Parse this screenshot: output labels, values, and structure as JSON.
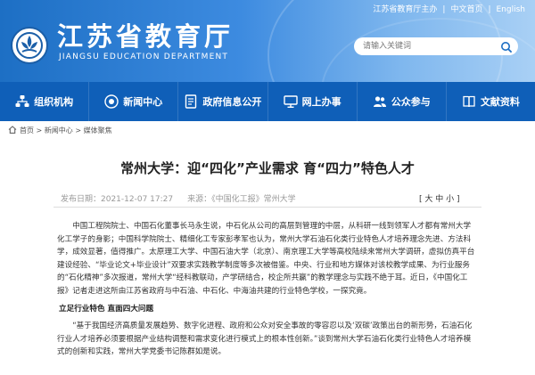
{
  "topbar": {
    "sponsor": "江苏省教育厅主办",
    "chinese": "中文首页",
    "english": "English",
    "sep": "|"
  },
  "site": {
    "title": "江苏省教育厅",
    "subtitle": "JIANGSU EDUCATION DEPARTMENT"
  },
  "search": {
    "placeholder": "请输入关键词"
  },
  "nav": {
    "items": [
      {
        "label": "组织机构",
        "icon": "org-icon"
      },
      {
        "label": "新闻中心",
        "icon": "news-icon"
      },
      {
        "label": "政府信息公开",
        "icon": "document-icon"
      },
      {
        "label": "网上办事",
        "icon": "computer-icon"
      },
      {
        "label": "公众参与",
        "icon": "people-icon"
      },
      {
        "label": "文献资料",
        "icon": "book-icon"
      }
    ]
  },
  "breadcrumb": {
    "home": "首页",
    "news": "新闻中心",
    "current": "媒体聚焦",
    "sep": ">"
  },
  "article": {
    "title": "常州大学：迎“四化”产业需求 育“四力”特色人才",
    "date": "发布日期：2021-12-07 17:27",
    "source": "来源：《中国化工报》常州大学",
    "font_size_label": "[ 大 中 小 ]",
    "p1": "中国工程院院士、中国石化董事长马永生说，中石化从公司的高层到管理的中层，从科研一线到领军人才都有常州大学化工学子的身影；中国科学院院士、精细化工专家彭孝军也认为，常州大学石油石化类行业特色人才培养理念先进、方法科学，成效显著，值得推广。太原理工大学、中国石油大学（北京）、南京理工大学等高校陆续来常州大学调研，虚拟仿真平台建设经验、“毕业论文+毕业设计”双要求实践教学制度等多次被借鉴。中央、行业和地方媒体对该校教学成果、为行业服务的“石化精神”多次报道，常州大学“经科教联动，产学研结合，校企所共赢”的教学理念与实践不绝于耳。近日，《中国化工报》记者走进这所由江苏省政府与中石油、中石化、中海油共建的行业特色学校，一探究竟。",
    "subheading": "立足行业特色 直面四大问题",
    "p2": "“基于我国经济高质量发展趋势、数字化进程、政府和公众对安全事故的零容忍以及‘双碳’政策出台的新形势，石油石化行业人才培养必须要根据产业结构调整和需求变化进行模式上的根本性创新。”谈到常州大学石油石化类行业特色人才培养模式的创新和实践，常州大学党委书记陈群如是说。"
  }
}
